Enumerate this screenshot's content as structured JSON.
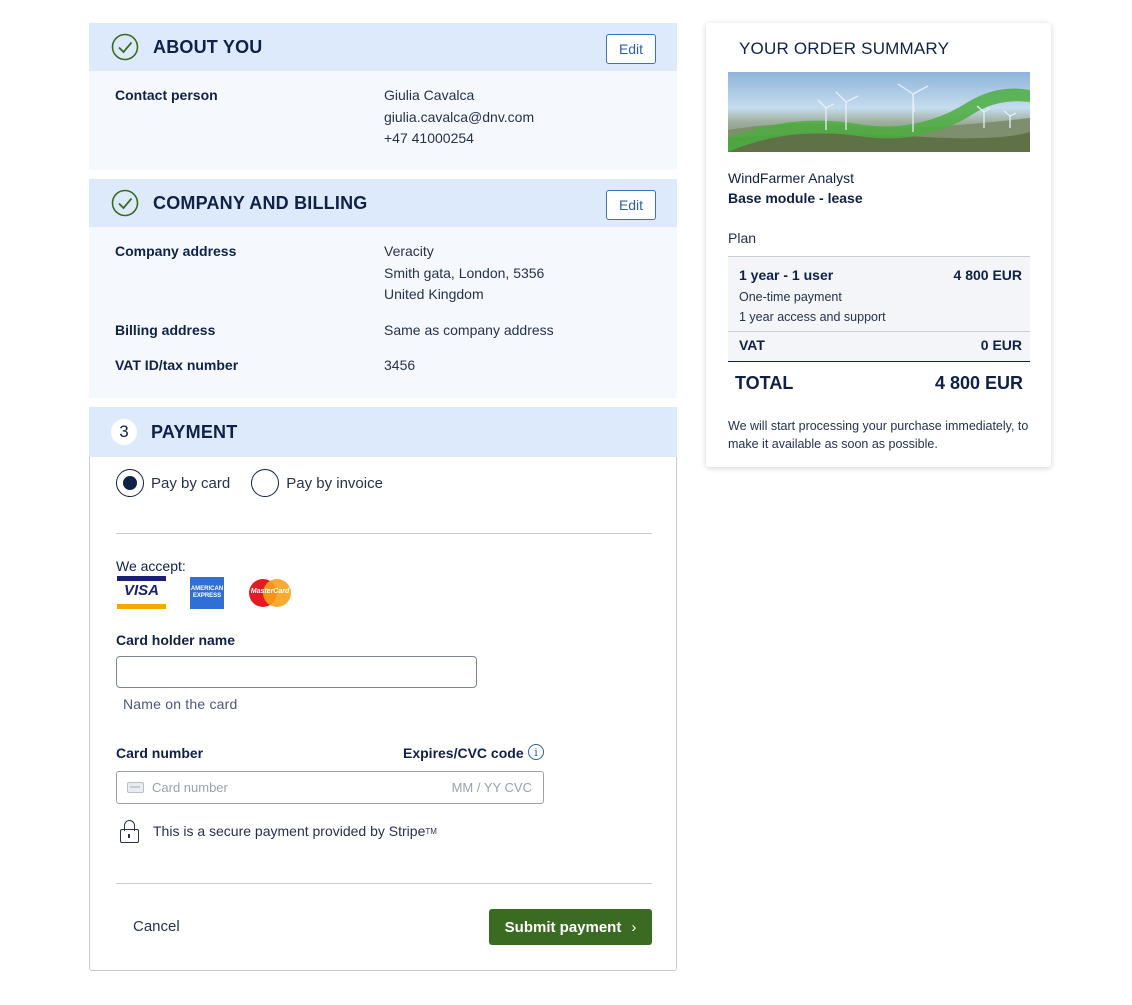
{
  "about": {
    "title": "ABOUT YOU",
    "edit_label": "Edit",
    "contact_label": "Contact person",
    "name": "Giulia Cavalca",
    "email": "giulia.cavalca@dnv.com",
    "phone": "+47 41000254"
  },
  "company": {
    "title": "COMPANY AND BILLING",
    "edit_label": "Edit",
    "address_label": "Company address",
    "address_line1": "Veracity",
    "address_line2": "Smith gata, London, 5356",
    "address_line3": "United Kingdom",
    "billing_label": "Billing address",
    "billing_value": "Same as company address",
    "vat_label": "VAT ID/tax number",
    "vat_value": "3456"
  },
  "payment": {
    "step": "3",
    "title": "PAYMENT",
    "pay_card": "Pay by card",
    "pay_invoice": "Pay by invoice",
    "selected": "card",
    "accept_label": "We accept:",
    "card_brands": {
      "visa": "VISA",
      "amex": "AMERICAN EXPRESS",
      "mastercard": "MasterCard"
    },
    "holder_label": "Card holder name",
    "holder_value": "",
    "holder_hint": "Name on the card",
    "number_label": "Card number",
    "expires_label": "Expires/CVC code",
    "number_placeholder": "Card number",
    "expiry_placeholder": "MM / YY  CVC",
    "secure_text": "This is a secure payment provided by Stripe",
    "tm": "TM",
    "cancel_label": "Cancel",
    "submit_label": "Submit payment"
  },
  "summary": {
    "title": "YOUR ORDER SUMMARY",
    "product_line1": "WindFarmer Analyst",
    "product_line2": "Base module - lease",
    "plan_label": "Plan",
    "plan_name": "1 year - 1 user",
    "plan_price": "4 800 EUR",
    "plan_detail1": "One-time payment",
    "plan_detail2": "1 year access and support",
    "vat_label": "VAT",
    "vat_price": "0 EUR",
    "total_label": "TOTAL",
    "total_price": "4 800 EUR",
    "note": "We will start processing your purchase immediately, to make it available as soon as possible."
  },
  "colors": {
    "header_bg": "#ddeafb",
    "primary_text": "#0f2147",
    "submit_bg": "#3b6b22",
    "check_green": "#3b6b22",
    "link_blue": "#2f5fa8"
  }
}
